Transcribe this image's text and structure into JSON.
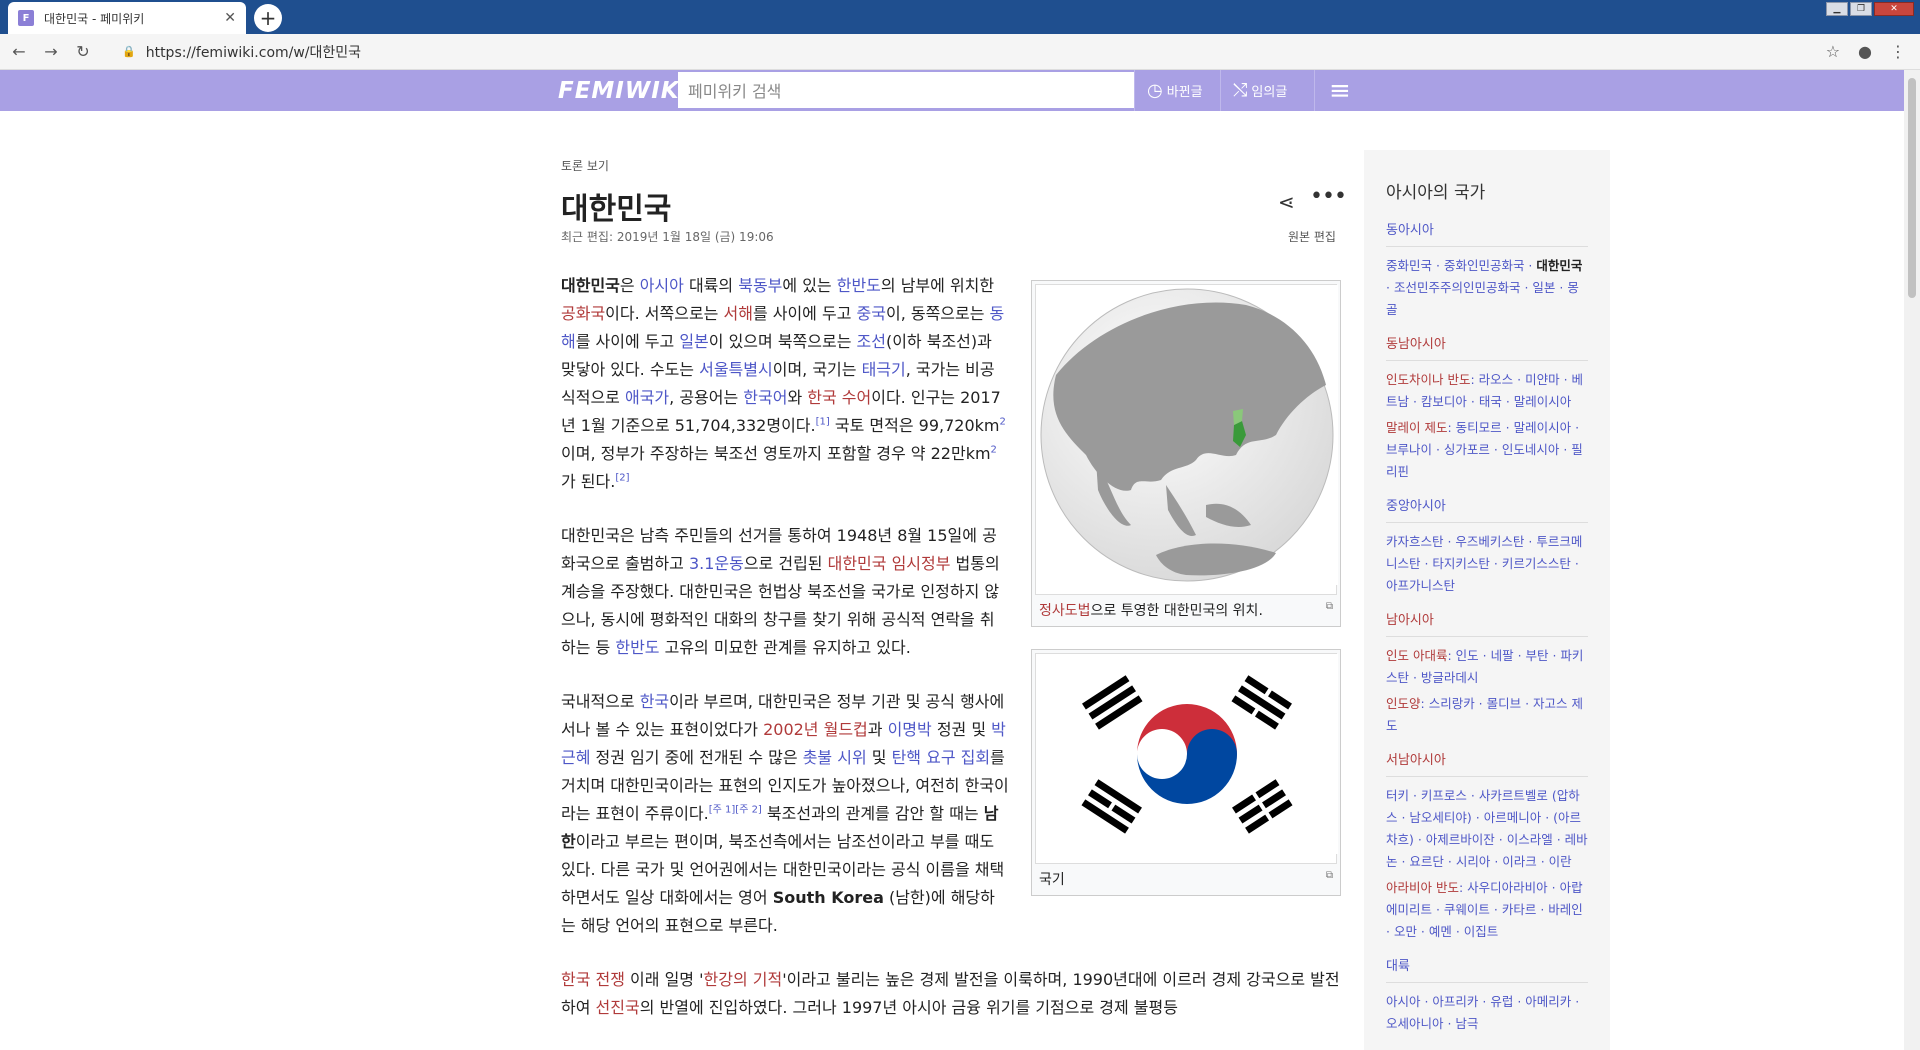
{
  "browser": {
    "tab_title": "대한민국 - 페미위키",
    "tab_favicon": "F",
    "url": "https://femiwiki.com/w/대한민국"
  },
  "header": {
    "logo": "FEMIWIKI",
    "search_placeholder": "페미위키 검색",
    "recent_label": "바뀐글",
    "random_label": "임의글"
  },
  "article": {
    "talk_link": "토론 보기",
    "title": "대한민국",
    "last_edit": "최근 편집: 2019년 1월 18일 (금) 19:06",
    "source_edit": "원본 편집",
    "map_caption_link": "정사도법",
    "map_caption_rest": "으로 투영한 대한민국의 위치.",
    "flag_caption": "국기"
  },
  "sidebar": {
    "title": "아시아의 국가",
    "sections": [
      "동아시아",
      "동남아시아",
      "중앙아시아",
      "남아시아",
      "서남아시아",
      "대륙"
    ]
  },
  "colors": {
    "header_bg": "#a9a0e4",
    "link": "#4e57c7",
    "redlink": "#b03a3a"
  }
}
